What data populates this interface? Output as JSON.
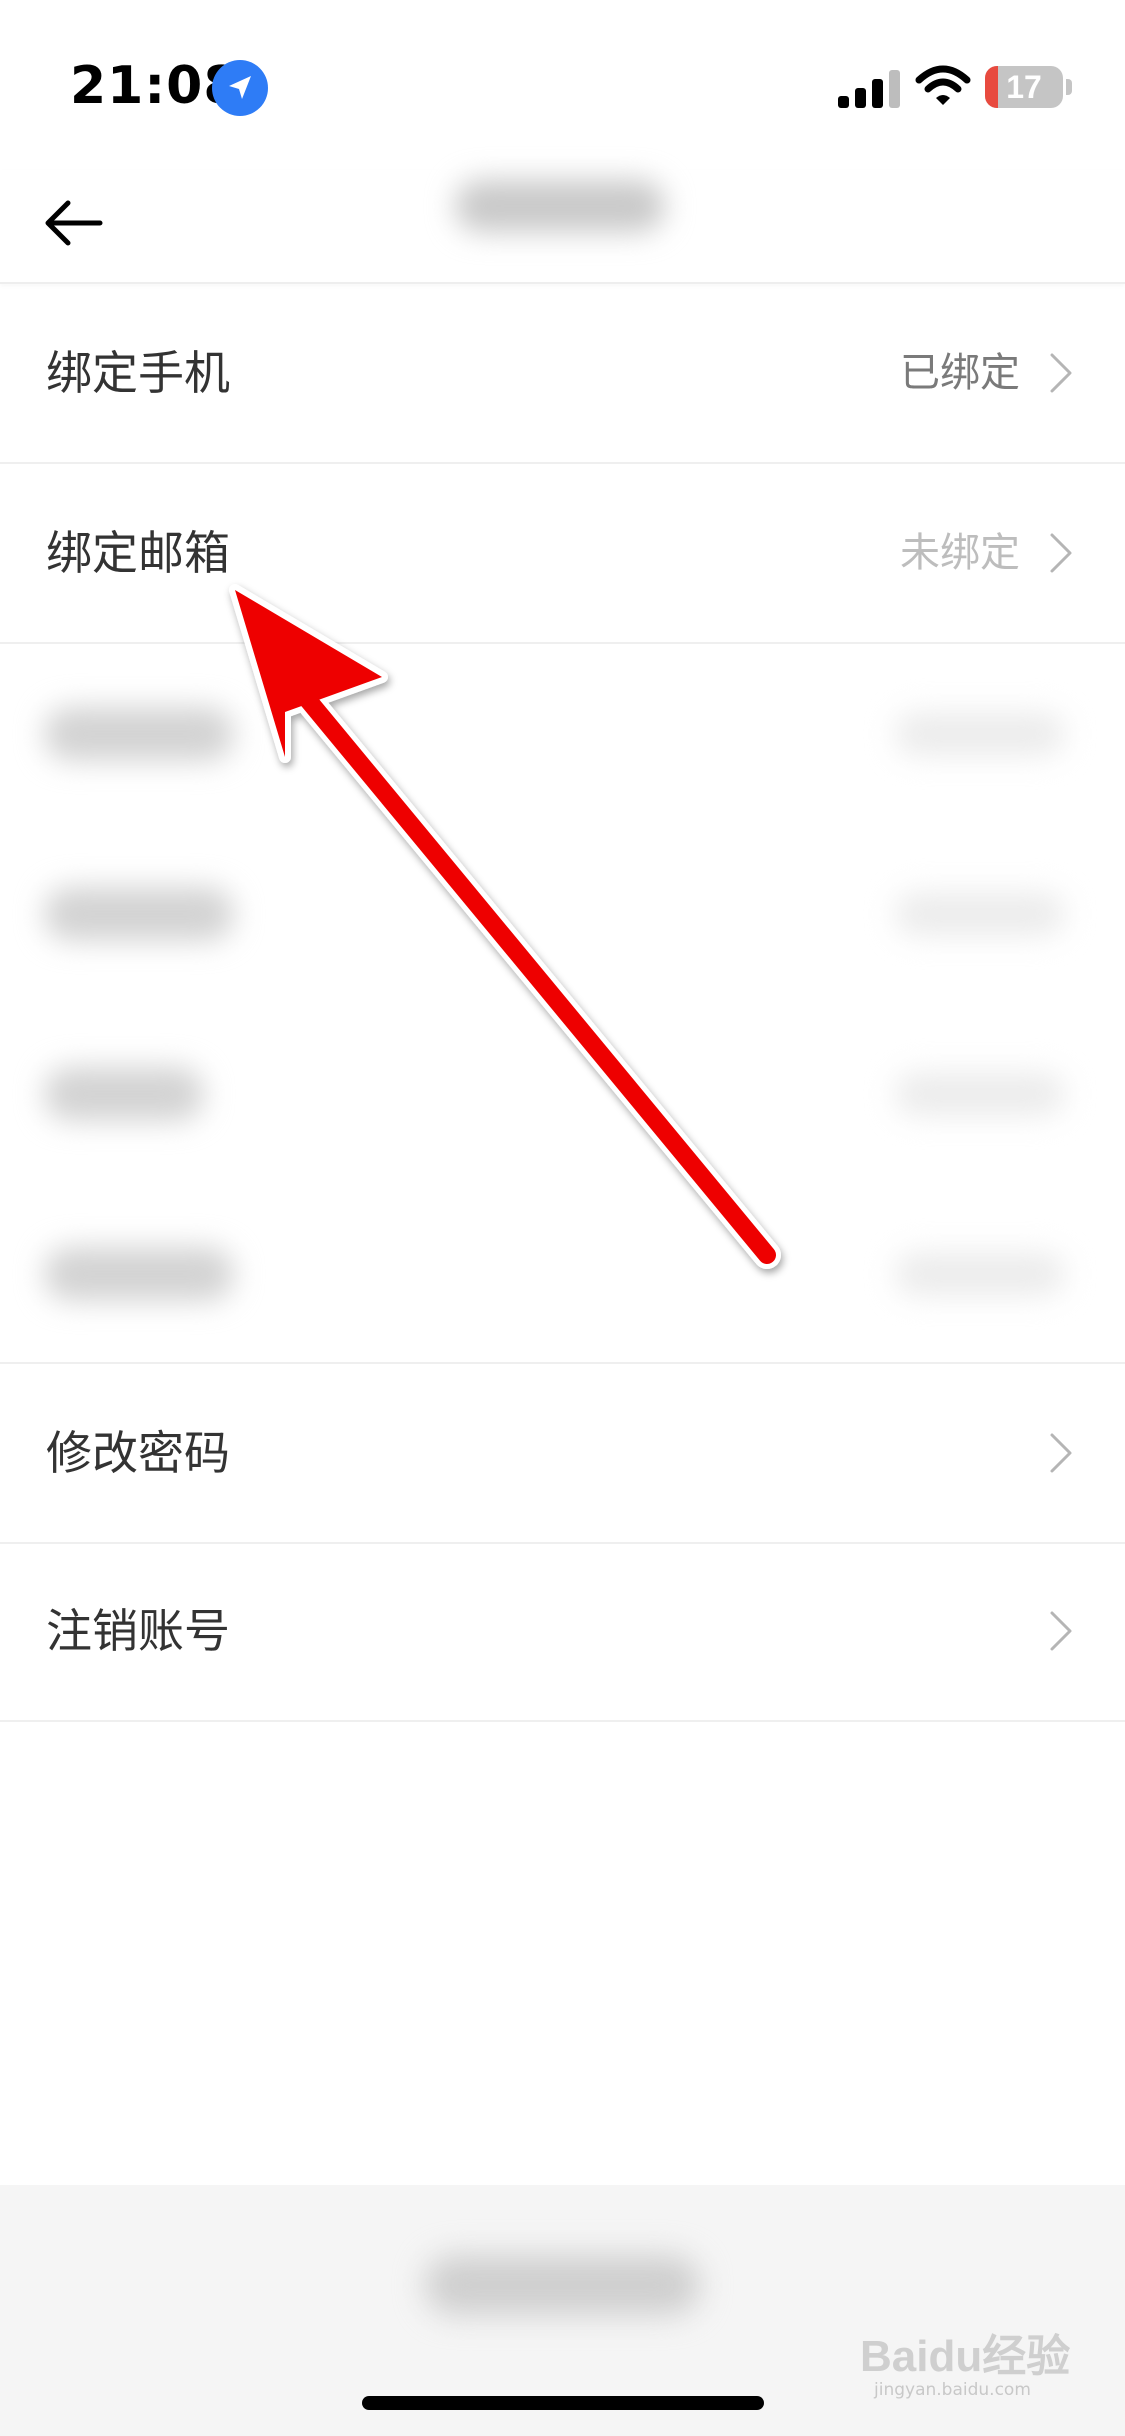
{
  "status_bar": {
    "time": "21:08",
    "battery_level": "17",
    "icons": [
      "location-arrow-icon",
      "cellular-signal-icon",
      "wifi-icon",
      "battery-icon"
    ],
    "battery_color": "#e84a3f",
    "location_color": "#2e7cf6"
  },
  "nav": {
    "back_icon": "arrow-left-icon"
  },
  "settings": {
    "phone": {
      "label": "绑定手机",
      "value": "已绑定"
    },
    "email": {
      "label": "绑定邮箱",
      "value": "未绑定"
    },
    "password": {
      "label": "修改密码"
    },
    "deactivate": {
      "label": "注销账号"
    }
  },
  "annotation": {
    "color": "#ee0000",
    "icon": "red-pointer-arrow"
  },
  "watermark": {
    "text": "Baidu经验",
    "sub": "jingyan.baidu.com"
  }
}
